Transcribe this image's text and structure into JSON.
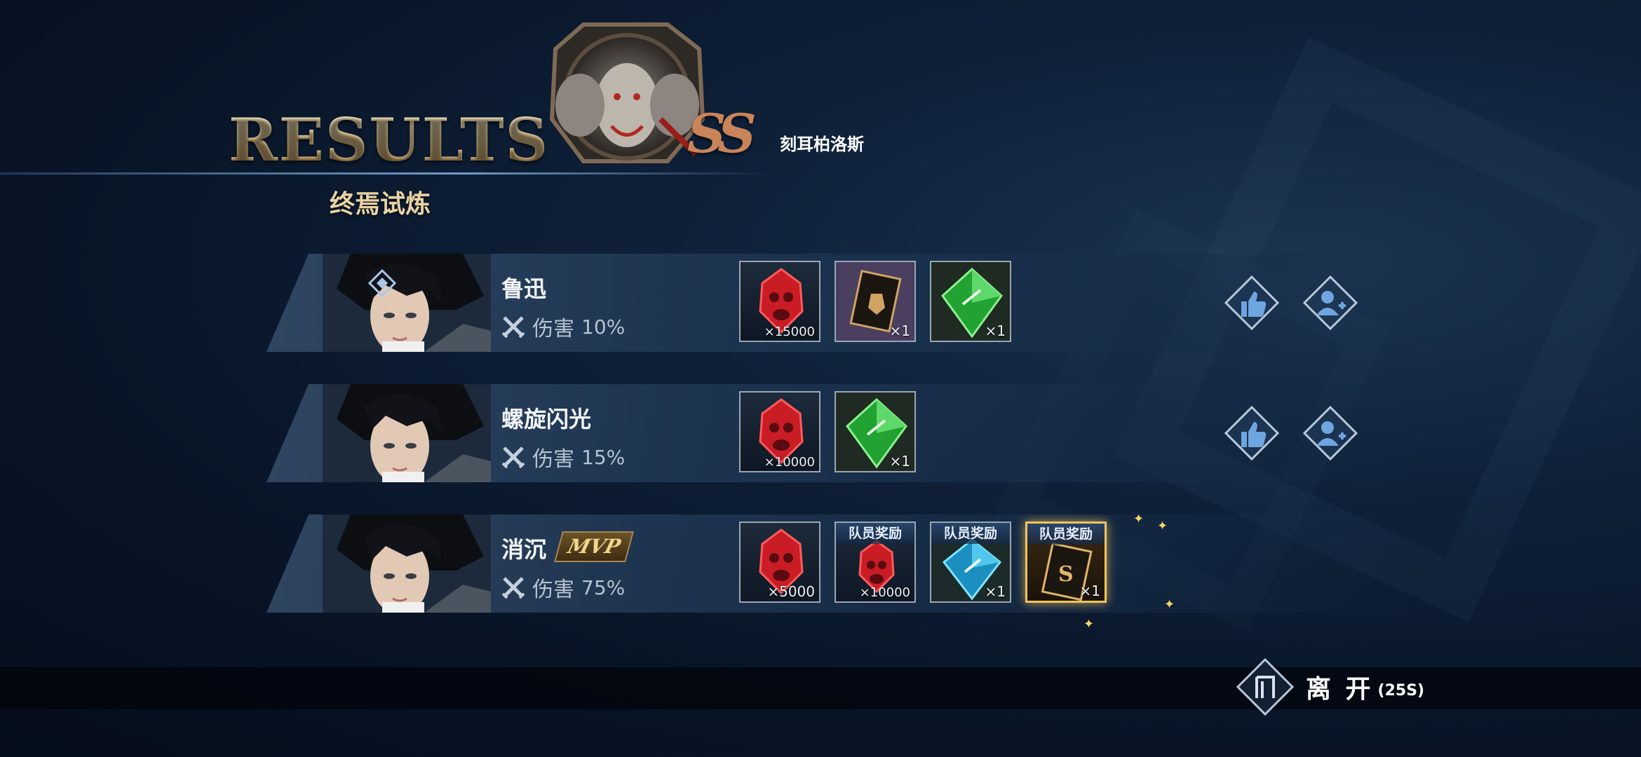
{
  "header": {
    "title": "RESULTS",
    "subtitle": "终焉试炼",
    "boss_name": "刻耳柏洛斯",
    "grade": "SS"
  },
  "players": [
    {
      "name": "鲁迅",
      "damage_label": "伤害",
      "damage_pct": "10%",
      "is_mvp": false,
      "is_self": true,
      "rewards": [
        {
          "icon": "red-gem-icon",
          "qty": "×15000",
          "tag": ""
        },
        {
          "icon": "card-icon",
          "qty": "×1",
          "tag": ""
        },
        {
          "icon": "green-crystal-icon",
          "qty": "×1",
          "tag": ""
        }
      ]
    },
    {
      "name": "螺旋闪光",
      "damage_label": "伤害",
      "damage_pct": "15%",
      "is_mvp": false,
      "rewards": [
        {
          "icon": "red-gem-icon",
          "qty": "×10000",
          "tag": ""
        },
        {
          "icon": "green-crystal-icon",
          "qty": "×1",
          "tag": ""
        }
      ]
    },
    {
      "name": "消沉",
      "damage_label": "伤害",
      "damage_pct": "75%",
      "is_mvp": true,
      "mvp_label": "MVP",
      "rewards": [
        {
          "icon": "red-gem-icon",
          "qty": "×5000",
          "tag": ""
        },
        {
          "icon": "red-gem-icon",
          "qty": "×10000",
          "tag": "队员奖励"
        },
        {
          "icon": "blue-crystal-icon",
          "qty": "×1",
          "tag": "队员奖励"
        },
        {
          "icon": "gold-card-icon",
          "qty": "×1",
          "tag": "队员奖励"
        }
      ]
    }
  ],
  "footer": {
    "leave_label": "离 开",
    "timer": "(25S)"
  }
}
